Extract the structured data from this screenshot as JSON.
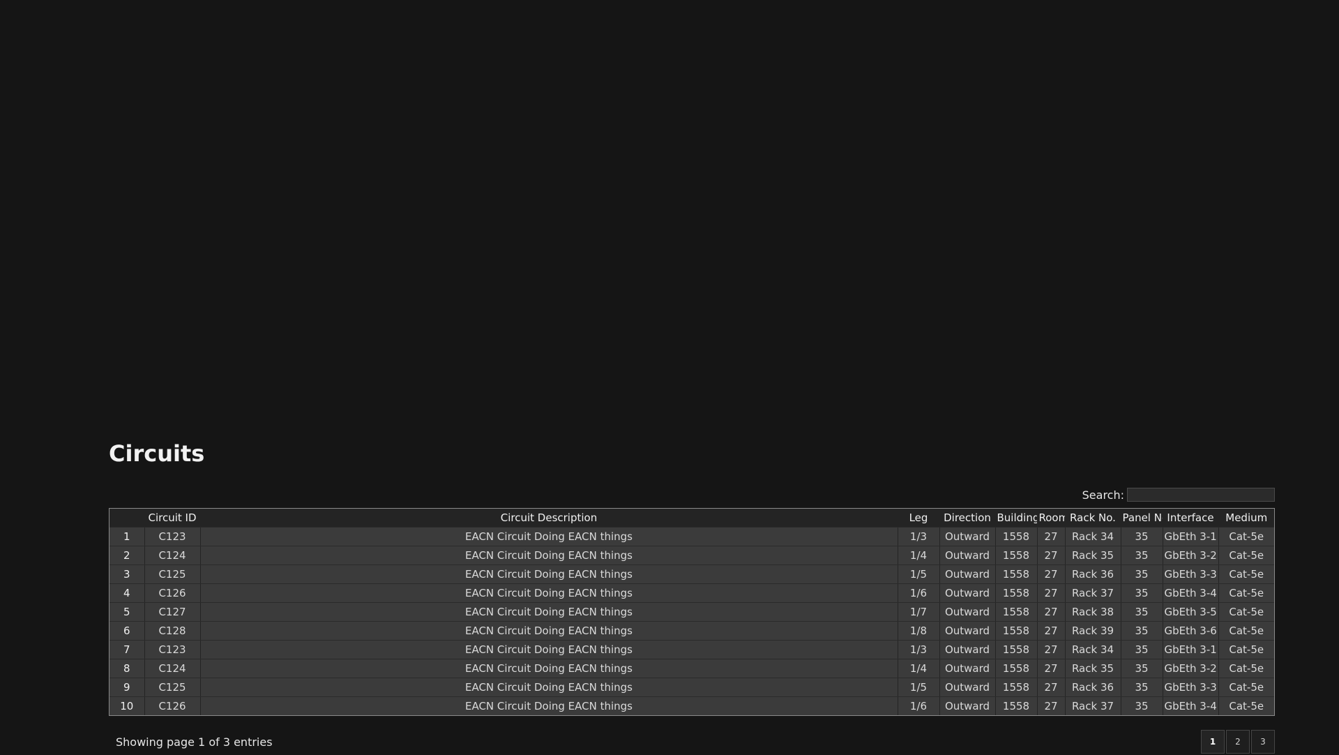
{
  "page": {
    "title": "Circuits"
  },
  "search": {
    "label": "Search:",
    "value": "",
    "placeholder": ""
  },
  "table": {
    "columns": [
      "",
      "Circuit ID",
      "Circuit Description",
      "Leg",
      "Direction",
      "Building",
      "Room",
      "Rack No.",
      "Panel No.",
      "Interface",
      "Medium"
    ],
    "rows": [
      [
        "1",
        "C123",
        "EACN Circuit Doing EACN things",
        "1/3",
        "Outward",
        "1558",
        "27",
        "Rack 34",
        "35",
        "GbEth 3-1",
        "Cat-5e"
      ],
      [
        "2",
        "C124",
        "EACN Circuit Doing EACN things",
        "1/4",
        "Outward",
        "1558",
        "27",
        "Rack 35",
        "35",
        "GbEth 3-2",
        "Cat-5e"
      ],
      [
        "3",
        "C125",
        "EACN Circuit Doing EACN things",
        "1/5",
        "Outward",
        "1558",
        "27",
        "Rack 36",
        "35",
        "GbEth 3-3",
        "Cat-5e"
      ],
      [
        "4",
        "C126",
        "EACN Circuit Doing EACN things",
        "1/6",
        "Outward",
        "1558",
        "27",
        "Rack 37",
        "35",
        "GbEth 3-4",
        "Cat-5e"
      ],
      [
        "5",
        "C127",
        "EACN Circuit Doing EACN things",
        "1/7",
        "Outward",
        "1558",
        "27",
        "Rack 38",
        "35",
        "GbEth 3-5",
        "Cat-5e"
      ],
      [
        "6",
        "C128",
        "EACN Circuit Doing EACN things",
        "1/8",
        "Outward",
        "1558",
        "27",
        "Rack 39",
        "35",
        "GbEth 3-6",
        "Cat-5e"
      ],
      [
        "7",
        "C123",
        "EACN Circuit Doing EACN things",
        "1/3",
        "Outward",
        "1558",
        "27",
        "Rack 34",
        "35",
        "GbEth 3-1",
        "Cat-5e"
      ],
      [
        "8",
        "C124",
        "EACN Circuit Doing EACN things",
        "1/4",
        "Outward",
        "1558",
        "27",
        "Rack 35",
        "35",
        "GbEth 3-2",
        "Cat-5e"
      ],
      [
        "9",
        "C125",
        "EACN Circuit Doing EACN things",
        "1/5",
        "Outward",
        "1558",
        "27",
        "Rack 36",
        "35",
        "GbEth 3-3",
        "Cat-5e"
      ],
      [
        "10",
        "C126",
        "EACN Circuit Doing EACN things",
        "1/6",
        "Outward",
        "1558",
        "27",
        "Rack 37",
        "35",
        "GbEth 3-4",
        "Cat-5e"
      ]
    ]
  },
  "footer": {
    "info": "Showing page 1 of 3 entries",
    "pages": [
      "1",
      "2",
      "3"
    ],
    "active_page": "1"
  }
}
